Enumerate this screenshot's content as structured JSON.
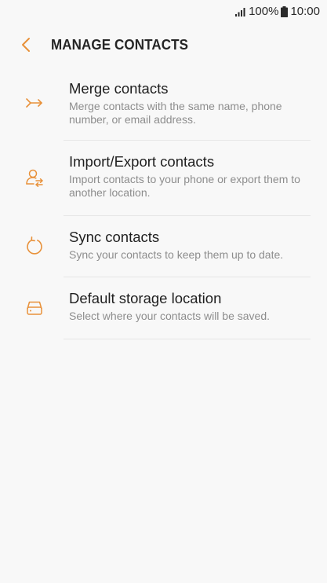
{
  "status_bar": {
    "battery": "100%",
    "time": "10:00",
    "signal_icon": "signal-bars-icon",
    "battery_icon": "battery-full-icon"
  },
  "header": {
    "back_icon": "chevron-left-icon",
    "title": "MANAGE CONTACTS"
  },
  "colors": {
    "accent": "#e8913a",
    "background": "#f8f8f8",
    "title_text": "#1f1f1f",
    "subtitle_text": "#8d8d8d",
    "divider": "#e6e6e6"
  },
  "items": [
    {
      "icon": "merge-arrows-icon",
      "title": "Merge contacts",
      "subtitle": "Merge contacts with the same name, phone number, or email address."
    },
    {
      "icon": "import-export-person-icon",
      "title": "Import/Export contacts",
      "subtitle": "Import contacts to your phone or export them to another location."
    },
    {
      "icon": "sync-icon",
      "title": "Sync contacts",
      "subtitle": "Sync your contacts to keep them up to date."
    },
    {
      "icon": "storage-drive-icon",
      "title": "Default storage location",
      "subtitle": "Select where your contacts will be saved."
    }
  ]
}
